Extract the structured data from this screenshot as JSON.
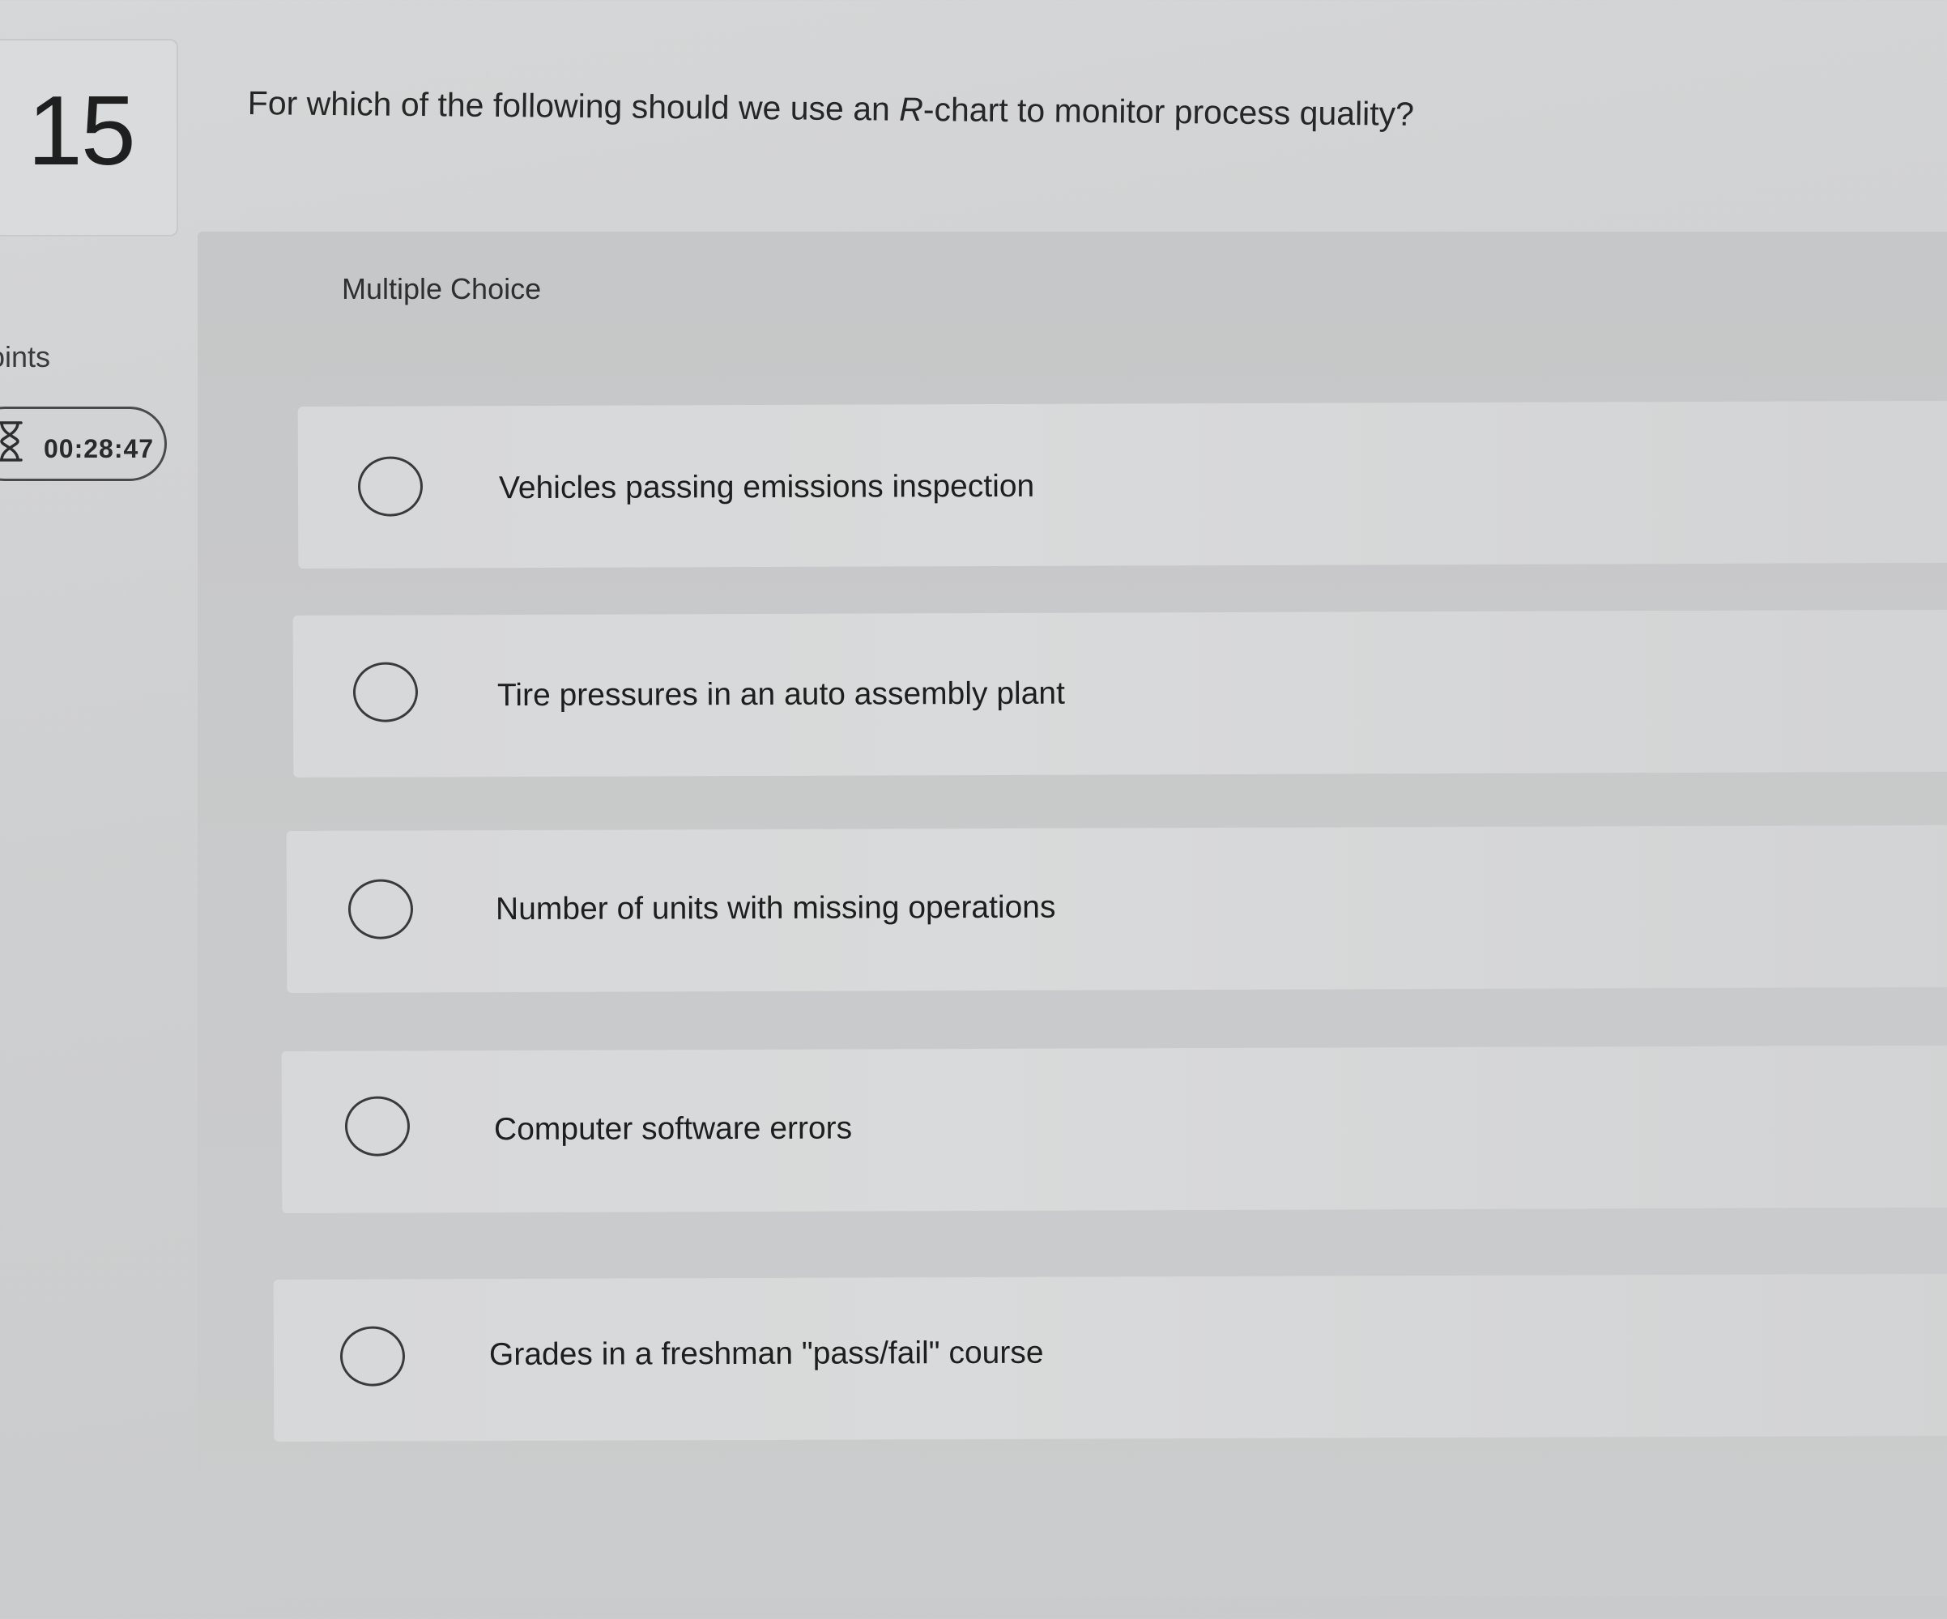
{
  "sidebar": {
    "question_number": "15",
    "points_label": "oints",
    "timer": "00:28:47"
  },
  "question": {
    "prefix": "For which of the following should we use an ",
    "italic": "R",
    "suffix": "-chart to monitor process quality?"
  },
  "answer_type": "Multiple Choice",
  "options": [
    {
      "label": "Vehicles passing emissions inspection"
    },
    {
      "label": "Tire pressures in an auto assembly plant"
    },
    {
      "label": "Number of units with missing operations"
    },
    {
      "label": "Computer software errors"
    },
    {
      "label": "Grades in a freshman \"pass/fail\" course"
    }
  ]
}
